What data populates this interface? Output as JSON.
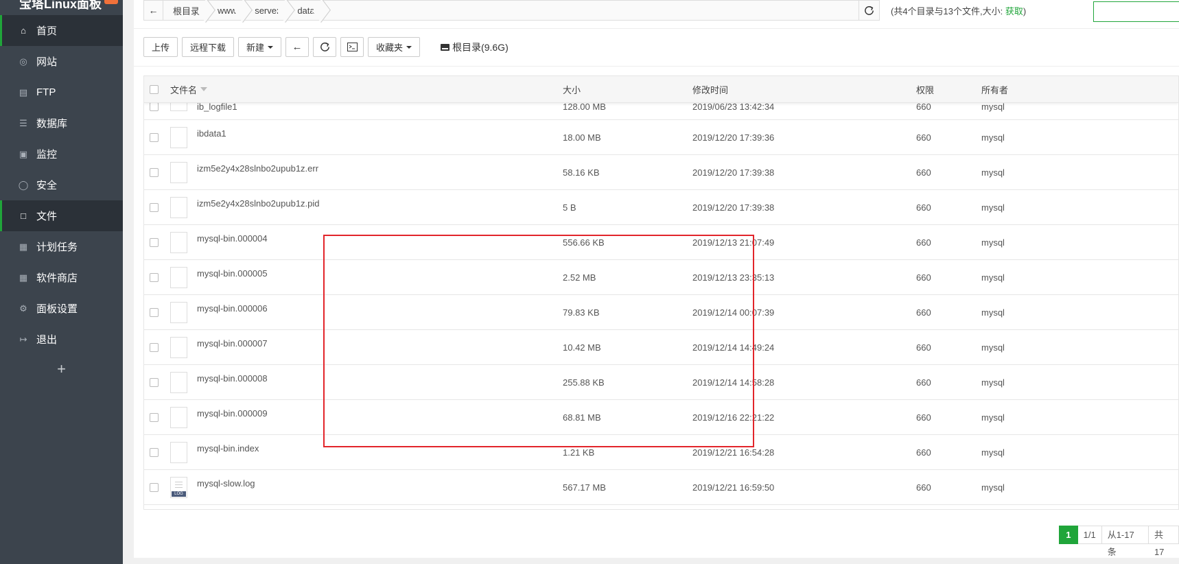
{
  "sidebar": {
    "logo_text": "宝塔Linux面板",
    "items": [
      {
        "label": "首页",
        "icon": "home-icon",
        "active": true
      },
      {
        "label": "网站",
        "icon": "globe-icon",
        "active": false
      },
      {
        "label": "FTP",
        "icon": "ftp-icon",
        "active": false
      },
      {
        "label": "数据库",
        "icon": "database-icon",
        "active": false
      },
      {
        "label": "监控",
        "icon": "monitor-icon",
        "active": false
      },
      {
        "label": "安全",
        "icon": "shield-icon",
        "active": false
      },
      {
        "label": "文件",
        "icon": "folder-icon",
        "active": true
      },
      {
        "label": "计划任务",
        "icon": "calendar-icon",
        "active": false
      },
      {
        "label": "软件商店",
        "icon": "apps-icon",
        "active": false
      },
      {
        "label": "面板设置",
        "icon": "gear-icon",
        "active": false
      },
      {
        "label": "退出",
        "icon": "logout-icon",
        "active": false
      }
    ],
    "add_label": "+"
  },
  "pathbar": {
    "crumbs": [
      "根目录",
      "www",
      "server",
      "data"
    ],
    "dir_info": "(共4个目录与13个文件,大小:",
    "get_label": "获取",
    "dir_info_end": ")"
  },
  "toolbar": {
    "upload": "上传",
    "remote_download": "远程下载",
    "new": "新建",
    "favorites": "收藏夹",
    "disk_label": "根目录(9.6G)"
  },
  "table": {
    "headers": {
      "name": "文件名",
      "size": "大小",
      "time": "修改时间",
      "perm": "权限",
      "owner": "所有者"
    },
    "rows": [
      {
        "name": "ib_logfile1",
        "size": "128.00 MB",
        "time": "2019/06/23 13:42:34",
        "perm": "660",
        "owner": "mysql",
        "type": "file"
      },
      {
        "name": "ibdata1",
        "size": "18.00 MB",
        "time": "2019/12/20 17:39:36",
        "perm": "660",
        "owner": "mysql",
        "type": "file"
      },
      {
        "name": "izm5e2y4x28slnbo2upub1z.err",
        "size": "58.16 KB",
        "time": "2019/12/20 17:39:38",
        "perm": "660",
        "owner": "mysql",
        "type": "file"
      },
      {
        "name": "izm5e2y4x28slnbo2upub1z.pid",
        "size": "5 B",
        "time": "2019/12/20 17:39:38",
        "perm": "660",
        "owner": "mysql",
        "type": "file"
      },
      {
        "name": "mysql-bin.000004",
        "size": "556.66 KB",
        "time": "2019/12/13 21:07:49",
        "perm": "660",
        "owner": "mysql",
        "type": "file"
      },
      {
        "name": "mysql-bin.000005",
        "size": "2.52 MB",
        "time": "2019/12/13 23:35:13",
        "perm": "660",
        "owner": "mysql",
        "type": "file"
      },
      {
        "name": "mysql-bin.000006",
        "size": "79.83 KB",
        "time": "2019/12/14 00:07:39",
        "perm": "660",
        "owner": "mysql",
        "type": "file"
      },
      {
        "name": "mysql-bin.000007",
        "size": "10.42 MB",
        "time": "2019/12/14 14:49:24",
        "perm": "660",
        "owner": "mysql",
        "type": "file"
      },
      {
        "name": "mysql-bin.000008",
        "size": "255.88 KB",
        "time": "2019/12/14 14:58:28",
        "perm": "660",
        "owner": "mysql",
        "type": "file"
      },
      {
        "name": "mysql-bin.000009",
        "size": "68.81 MB",
        "time": "2019/12/16 22:21:22",
        "perm": "660",
        "owner": "mysql",
        "type": "file"
      },
      {
        "name": "mysql-bin.index",
        "size": "1.21 KB",
        "time": "2019/12/21 16:54:28",
        "perm": "660",
        "owner": "mysql",
        "type": "file"
      },
      {
        "name": "mysql-slow.log",
        "size": "567.17 MB",
        "time": "2019/12/21 16:59:50",
        "perm": "660",
        "owner": "mysql",
        "type": "log"
      }
    ],
    "log_tag": "LOG"
  },
  "pager": {
    "current": "1",
    "pages": "1/1",
    "range": "从1-17条",
    "total": "共17"
  },
  "colors": {
    "accent": "#20a53a",
    "sidebar_bg": "#3c444d",
    "highlight": "#e2242a"
  }
}
